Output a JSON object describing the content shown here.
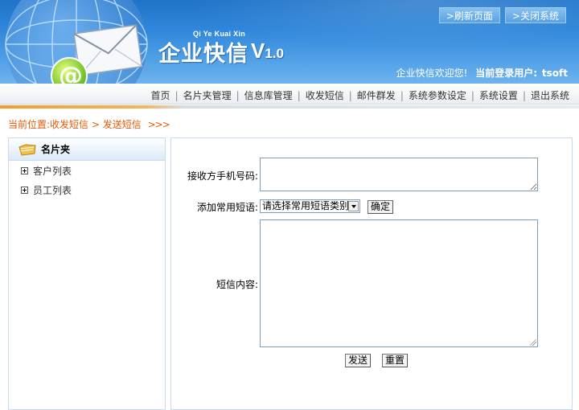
{
  "header": {
    "logo_subtitle": "Qi Ye Kuai Xin",
    "logo_title": "企业快信",
    "logo_version_major": "V",
    "logo_version_minor": "1.0",
    "top_links": [
      ">刷新页面",
      ">关闭系统"
    ],
    "welcome_text": "企业快信欢迎您!",
    "user_label": "当前登录用户:",
    "username": "tsoft"
  },
  "nav": {
    "items": [
      "首页",
      "名片夹管理",
      "信息库管理",
      "收发短信",
      "邮件群发",
      "系统参数设定",
      "系统设置",
      "退出系统"
    ]
  },
  "breadcrumb": {
    "label": "当前位置:",
    "section": "收发短信",
    "separator": ">",
    "page": "发送短信",
    "arrows": ">>>"
  },
  "sidebar": {
    "title": "名片夹",
    "items": [
      {
        "label": "客户列表",
        "icon": "plus-expand-icon"
      },
      {
        "label": "员工列表",
        "icon": "plus-expand-icon"
      }
    ]
  },
  "form": {
    "phone_label": "接收方手机号码:",
    "phone_value": "",
    "phrase_label": "添加常用短语:",
    "phrase_select": "请选择常用短语类别",
    "confirm_button": "确定",
    "content_label": "短信内容:",
    "content_value": "",
    "send_button": "发送",
    "reset_button": "重置"
  },
  "colors": {
    "header_blue": "#2f86da",
    "accent_orange": "#f79a2e",
    "breadcrumb_orange": "#e45a06",
    "panel_border": "#c7dcf0"
  }
}
